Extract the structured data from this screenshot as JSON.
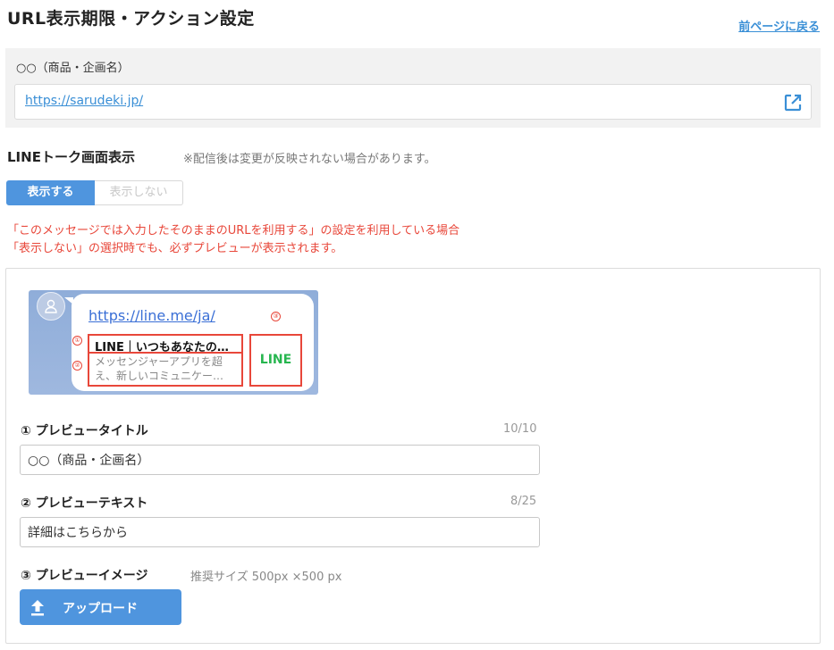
{
  "header": {
    "title": "URL表示期限・アクション設定",
    "back_link": "前ページに戻る"
  },
  "url_section": {
    "name": "○○（商品・企画名）",
    "url": "https://sarudeki.jp/",
    "open_icon": "external-link-icon"
  },
  "talk_display": {
    "label": "LINEトーク画面表示",
    "note": "※配信後は変更が反映されない場合があります。",
    "options": [
      "表示する",
      "表示しない"
    ],
    "selected": "表示する",
    "warning_line1": "「このメッセージでは入力したそのままのURLを利用する」の設定を利用している場合",
    "warning_line2": "「表示しない」の選択時でも、必ずプレビューが表示されます。"
  },
  "preview": {
    "link": "https://line.me/ja/",
    "card_title": "LINE｜いつもあなたの…",
    "card_text": "メッセンジャーアプリを超え、新しいコミュニケー…",
    "image_text": "LINE",
    "markers": [
      "①",
      "②",
      "③"
    ]
  },
  "form": {
    "title_label": "① プレビュータイトル",
    "title_counter": "10/10",
    "title_value": "○○（商品・企画名）",
    "text_label": "② プレビューテキスト",
    "text_counter": "8/25",
    "text_value": "詳細はこちらから",
    "image_label": "③ プレビューイメージ",
    "image_hint": "推奨サイズ 500px ×500 px",
    "upload_label": "アップロード"
  },
  "colors": {
    "accent": "#4f95de",
    "link": "#3a8fd6",
    "warning": "#e8473a",
    "line_green": "#27b64f"
  }
}
